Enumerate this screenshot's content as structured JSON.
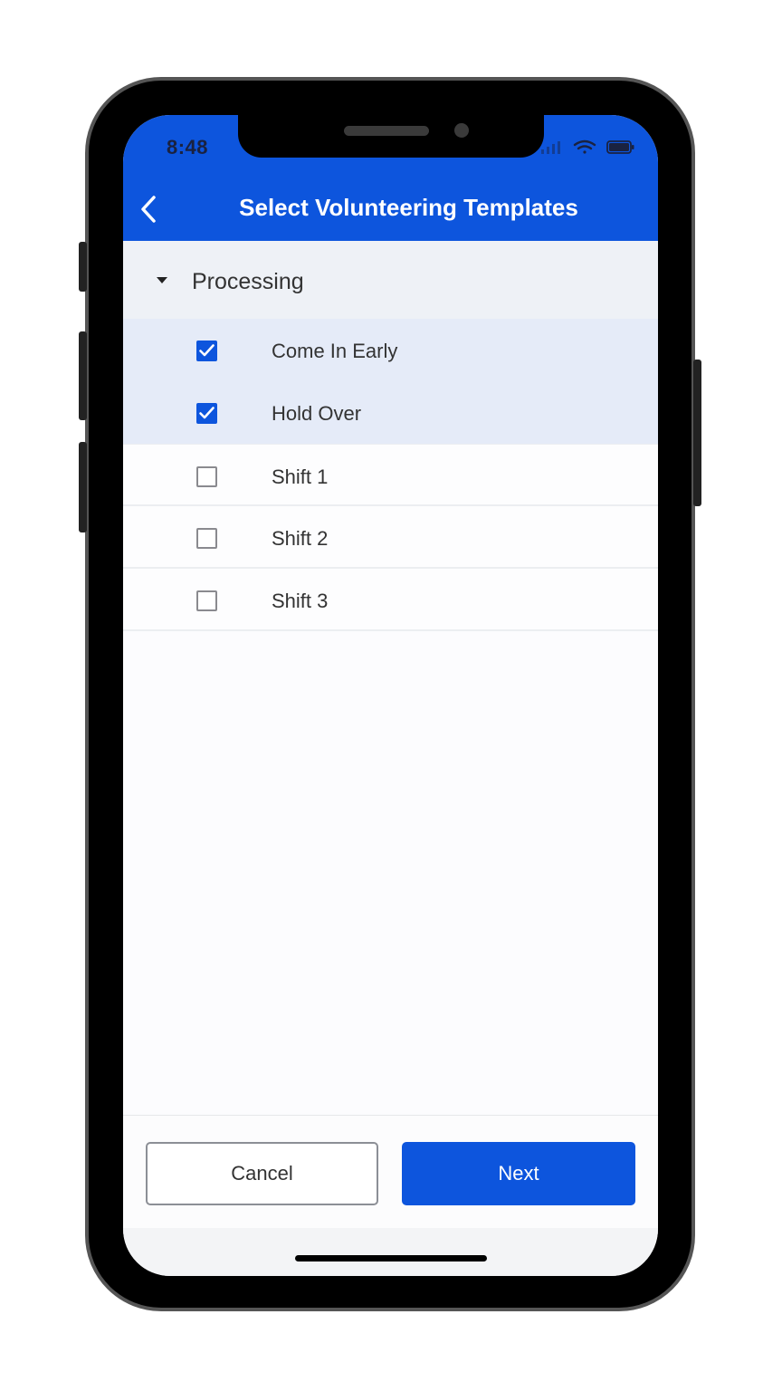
{
  "status_bar": {
    "time": "8:48"
  },
  "header": {
    "title": "Select Volunteering Templates",
    "back_icon": "chevron-left-icon"
  },
  "group": {
    "label": "Processing",
    "expanded": true
  },
  "items": [
    {
      "label": "Come In Early",
      "checked": true
    },
    {
      "label": "Hold Over",
      "checked": true
    },
    {
      "label": "Shift 1",
      "checked": false
    },
    {
      "label": "Shift 2",
      "checked": false
    },
    {
      "label": "Shift 3",
      "checked": false
    }
  ],
  "footer": {
    "cancel_label": "Cancel",
    "next_label": "Next"
  },
  "colors": {
    "accent": "#0d55dd",
    "selected_row": "#e5ebf8",
    "group_bg": "#eef1f6"
  }
}
